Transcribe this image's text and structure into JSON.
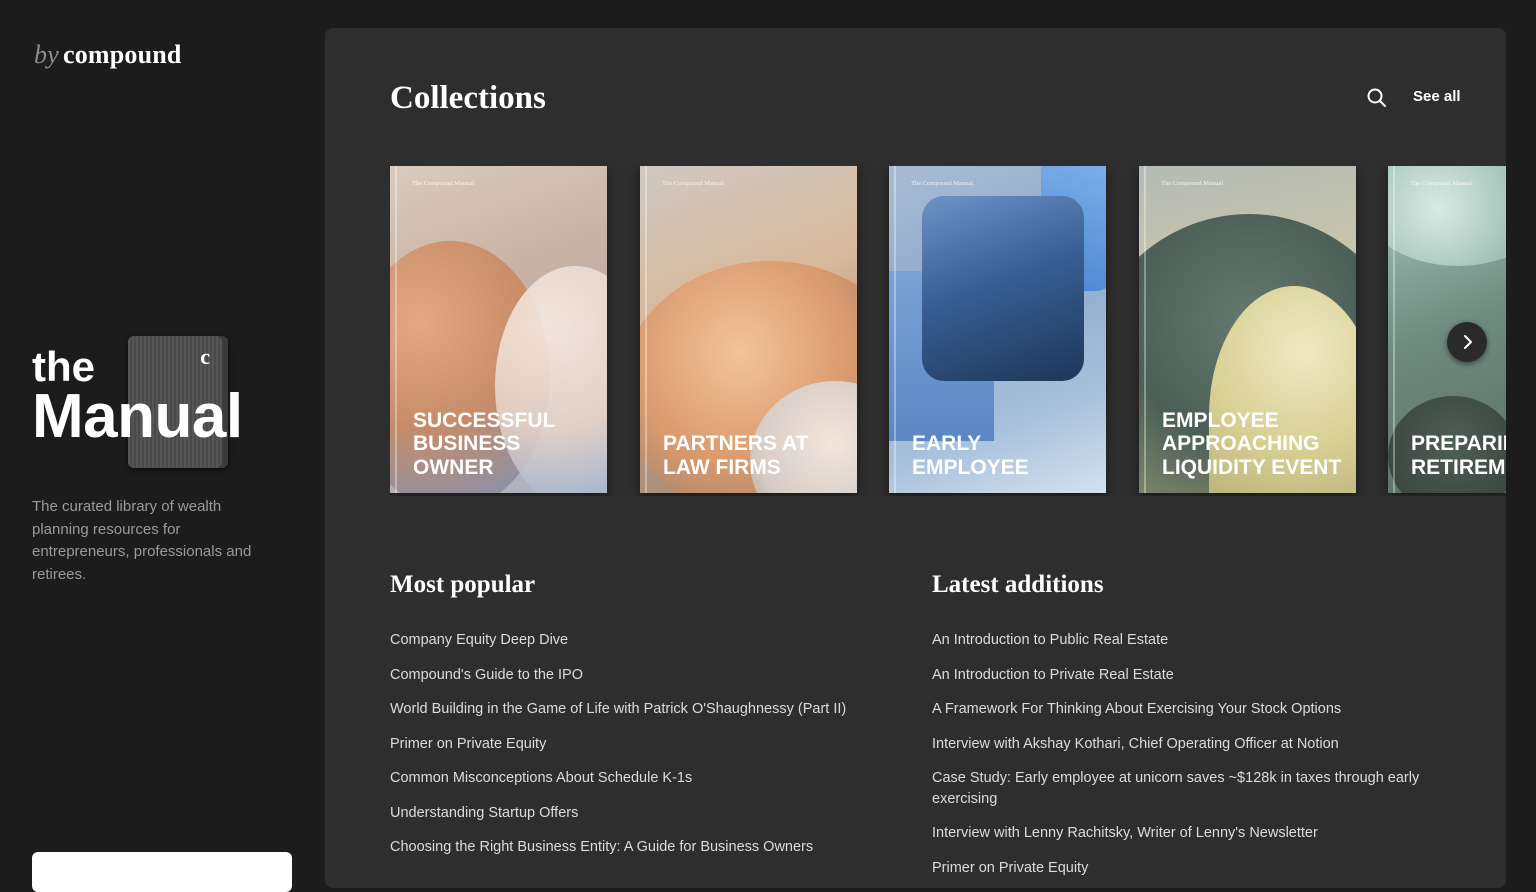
{
  "brand": {
    "by": "by",
    "name": "compound"
  },
  "logo": {
    "the": "the",
    "manual": "Manual",
    "mark": "c"
  },
  "tagline": "The curated library of wealth planning resources for entrepreneurs, professionals and retirees.",
  "collections": {
    "title": "Collections",
    "see_all": "See all",
    "cards": [
      {
        "label": "The Compound Manual",
        "title": "Successful Business Owner"
      },
      {
        "label": "The Compound Manual",
        "title": "Partners at Law Firms"
      },
      {
        "label": "The Compound Manual",
        "title": "Early Employee"
      },
      {
        "label": "The Compound Manual",
        "title": "Employee Approaching Liquidity Event"
      },
      {
        "label": "The Compound Manual",
        "title": "Preparing Retirement"
      }
    ]
  },
  "most_popular": {
    "title": "Most popular",
    "items": [
      "Company Equity Deep Dive",
      "Compound's Guide to the IPO",
      "World Building in the Game of Life with Patrick O'Shaughnessy (Part II)",
      "Primer on Private Equity",
      "Common Misconceptions About Schedule K-1s",
      "Understanding Startup Offers",
      "Choosing the Right Business Entity: A Guide for Business Owners"
    ]
  },
  "latest_additions": {
    "title": "Latest additions",
    "items": [
      "An Introduction to Public Real Estate",
      "An Introduction to Private Real Estate",
      "A Framework For Thinking About Exercising Your Stock Options",
      "Interview with Akshay Kothari, Chief Operating Officer at Notion",
      "Case Study: Early employee at unicorn saves ~$128k in taxes through early exercising",
      "Interview with Lenny Rachitsky, Writer of Lenny's Newsletter",
      "Primer on Private Equity"
    ]
  },
  "icons": {
    "search": "search-icon",
    "next": "chevron-right-icon"
  },
  "colors": {
    "background": "#1c1c1c",
    "panel": "#2e2e2e",
    "text": "#ffffff",
    "muted": "#9a9a9a"
  }
}
